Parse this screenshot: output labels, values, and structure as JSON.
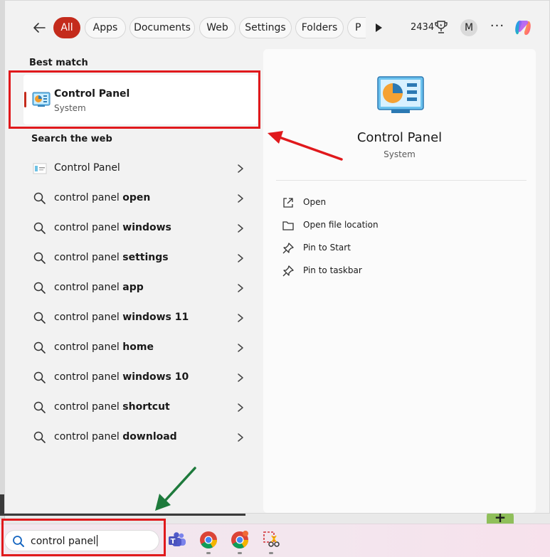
{
  "topbar": {
    "filters": [
      "All",
      "Apps",
      "Documents",
      "Web",
      "Settings",
      "Folders",
      "P"
    ],
    "active_filter": "All",
    "points": "2434",
    "avatar_initial": "M",
    "more_label": "···"
  },
  "best_match": {
    "heading": "Best match",
    "title": "Control Panel",
    "subtitle": "System"
  },
  "web": {
    "heading": "Search the web",
    "items": [
      {
        "prefix": "Control Panel",
        "bold": ""
      },
      {
        "prefix": "control panel ",
        "bold": "open"
      },
      {
        "prefix": "control panel ",
        "bold": "windows"
      },
      {
        "prefix": "control panel ",
        "bold": "settings"
      },
      {
        "prefix": "control panel ",
        "bold": "app"
      },
      {
        "prefix": "control panel ",
        "bold": "windows 11"
      },
      {
        "prefix": "control panel ",
        "bold": "home"
      },
      {
        "prefix": "control panel ",
        "bold": "windows 10"
      },
      {
        "prefix": "control panel ",
        "bold": "shortcut"
      },
      {
        "prefix": "control panel ",
        "bold": "download"
      }
    ]
  },
  "detail": {
    "title": "Control Panel",
    "subtitle": "System",
    "actions": [
      {
        "label": "Open",
        "icon": "open-icon"
      },
      {
        "label": "Open file location",
        "icon": "folder-icon"
      },
      {
        "label": "Pin to Start",
        "icon": "pin-icon"
      },
      {
        "label": "Pin to taskbar",
        "icon": "pin-icon"
      }
    ]
  },
  "taskbar": {
    "search_value": "control panel",
    "apps": [
      "teams-icon",
      "chrome-icon",
      "chrome-profile-icon",
      "snipping-tool-icon"
    ]
  },
  "colors": {
    "accent": "#c42b1c",
    "highlight_box": "#e0191c",
    "red_arrow": "#e0191c",
    "green_arrow": "#1e7a3c"
  }
}
